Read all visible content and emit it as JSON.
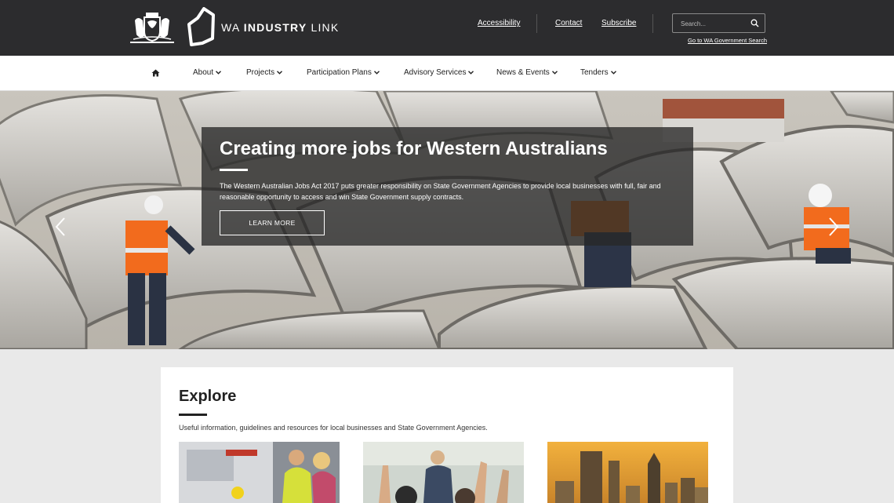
{
  "header": {
    "brand_prefix": "WA ",
    "brand_bold": "INDUSTRY",
    "brand_suffix": " LINK",
    "links": [
      "Accessibility",
      "Contact",
      "Subscribe"
    ],
    "search_placeholder": "Search...",
    "gov_search_link": "Go to WA Government Search",
    "background_color": "#2c2c2e"
  },
  "nav": {
    "items": [
      "About",
      "Projects",
      "Participation Plans",
      "Advisory Services",
      "News & Events",
      "Tenders"
    ]
  },
  "hero": {
    "title": "Creating more jobs for Western Australians",
    "body": "The Western Australian Jobs Act 2017 puts greater responsibility on State Government Agencies to provide local businesses with full, fair and reasonable opportunity to access and win State Government supply contracts.",
    "button_label": "LEARN MORE"
  },
  "explore": {
    "title": "Explore",
    "description": "Useful information, guidelines and resources for local businesses and State Government Agencies."
  }
}
